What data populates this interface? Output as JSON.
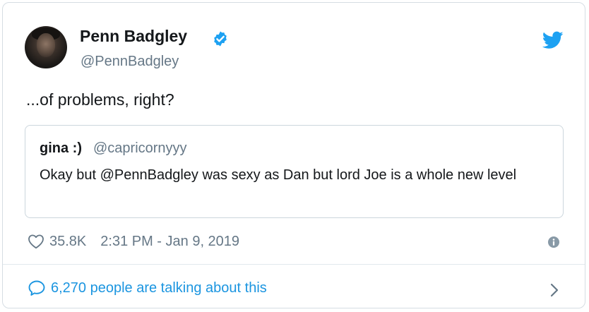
{
  "tweet": {
    "author": {
      "display_name": "Penn Badgley",
      "handle": "@PennBadgley",
      "verified": true,
      "avatar_icon": "profile-photo"
    },
    "text": "...of problems, right?",
    "quoted_tweet": {
      "display_name": "gina :)",
      "handle": "@capricornyyy",
      "text": "Okay but @PennBadgley was sexy as Dan but lord Joe is a whole new level"
    },
    "likes": "35.8K",
    "timestamp": "2:31 PM - Jan 9, 2019",
    "talking_about": "6,270 people are talking about this"
  },
  "icons": {
    "brand": "twitter-bird-icon",
    "verified": "verified-badge-icon",
    "like": "heart-icon",
    "info": "info-icon",
    "reply": "reply-bubble-icon",
    "chevron": "chevron-right-icon"
  },
  "colors": {
    "brand_blue": "#1da1f2",
    "link_blue": "#1b95e0",
    "text": "#14171a",
    "secondary_text": "#657786",
    "border": "#d6dde3"
  }
}
